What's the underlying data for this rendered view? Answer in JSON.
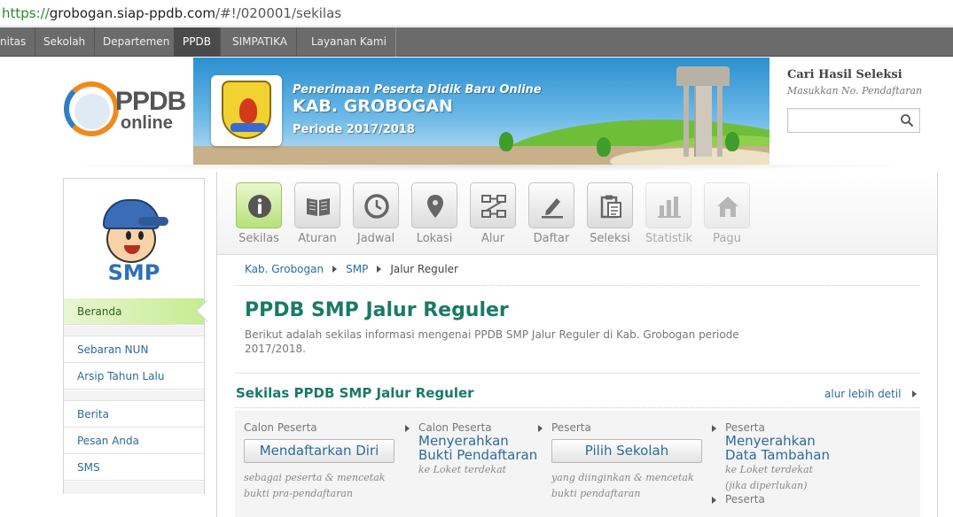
{
  "browser": {
    "url_scheme": "https://",
    "url_host": "grobogan.siap-ppdb.com",
    "url_path": "/#!/020001/sekilas"
  },
  "topnav": {
    "items": [
      {
        "label": "nitas"
      },
      {
        "label": "Sekolah"
      },
      {
        "label": "Departemen"
      },
      {
        "label": "PPDB"
      },
      {
        "label": "SIMPATIKA"
      },
      {
        "label": "Layanan Kami"
      }
    ],
    "active": "PPDB"
  },
  "logo": {
    "ppdb": "PPDB",
    "online": "online"
  },
  "banner": {
    "subtitle": "Penerimaan Peserta Didik Baru Online",
    "title": "KAB. GROBOGAN",
    "period": "Periode 2017/2018"
  },
  "search": {
    "title": "Cari Hasil Seleksi",
    "hint": "Masukkan No. Pendaftaran",
    "value": "",
    "icon": "search-icon"
  },
  "sidebar": {
    "level": "SMP",
    "items": [
      {
        "label": "Beranda",
        "active": true
      },
      {
        "label": "Sebaran NUN"
      },
      {
        "label": "Arsip Tahun Lalu"
      },
      {
        "label": "Berita"
      },
      {
        "label": "Pesan Anda"
      },
      {
        "label": "SMS"
      }
    ]
  },
  "iconnav": {
    "items": [
      {
        "label": "Sekilas",
        "icon": "info-icon",
        "active": true
      },
      {
        "label": "Aturan",
        "icon": "book-icon"
      },
      {
        "label": "Jadwal",
        "icon": "clock-icon"
      },
      {
        "label": "Lokasi",
        "icon": "map-pin-icon"
      },
      {
        "label": "Alur",
        "icon": "flow-icon"
      },
      {
        "label": "Daftar",
        "icon": "pen-icon"
      },
      {
        "label": "Seleksi",
        "icon": "clipboard-icon"
      },
      {
        "label": "Statistik",
        "icon": "bar-chart-icon",
        "disabled": true
      },
      {
        "label": "Pagu",
        "icon": "home-icon",
        "disabled": true
      }
    ]
  },
  "breadcrumb": [
    "Kab. Grobogan",
    "SMP",
    "Jalur Reguler"
  ],
  "page": {
    "title": "PPDB SMP Jalur Reguler",
    "description": "Berikut adalah sekilas informasi mengenai PPDB SMP Jalur Reguler di Kab. Grobogan periode 2017/2018."
  },
  "section": {
    "title": "Sekilas PPDB SMP Jalur Reguler",
    "link": "alur lebih detil"
  },
  "steps": [
    {
      "caption": "Calon Peserta",
      "button": "Mendaftarkan Diri",
      "note1": "sebagai peserta & mencetak",
      "note2": "bukti pra-pendaftaran"
    },
    {
      "caption": "Calon Peserta",
      "big1": "Menyerahkan",
      "big2": "Bukti Pendaftaran",
      "note1": "ke Loket terdekat"
    },
    {
      "caption": "Peserta",
      "button": "Pilih Sekolah",
      "note1": "yang diinginkan & mencetak",
      "note2": "bukti pendaftaran"
    },
    {
      "caption": "Peserta",
      "big1": "Menyerahkan",
      "big2": "Data Tambahan",
      "note1": "ke Loket terdekat",
      "note2": "(jika diperlukan)",
      "next": "Peserta"
    }
  ],
  "colors": {
    "accent_green": "#1a7a66",
    "link_blue": "#2b6c9b",
    "nav_gray": "#6b6b6b",
    "active_tile": "#b7e17a"
  }
}
